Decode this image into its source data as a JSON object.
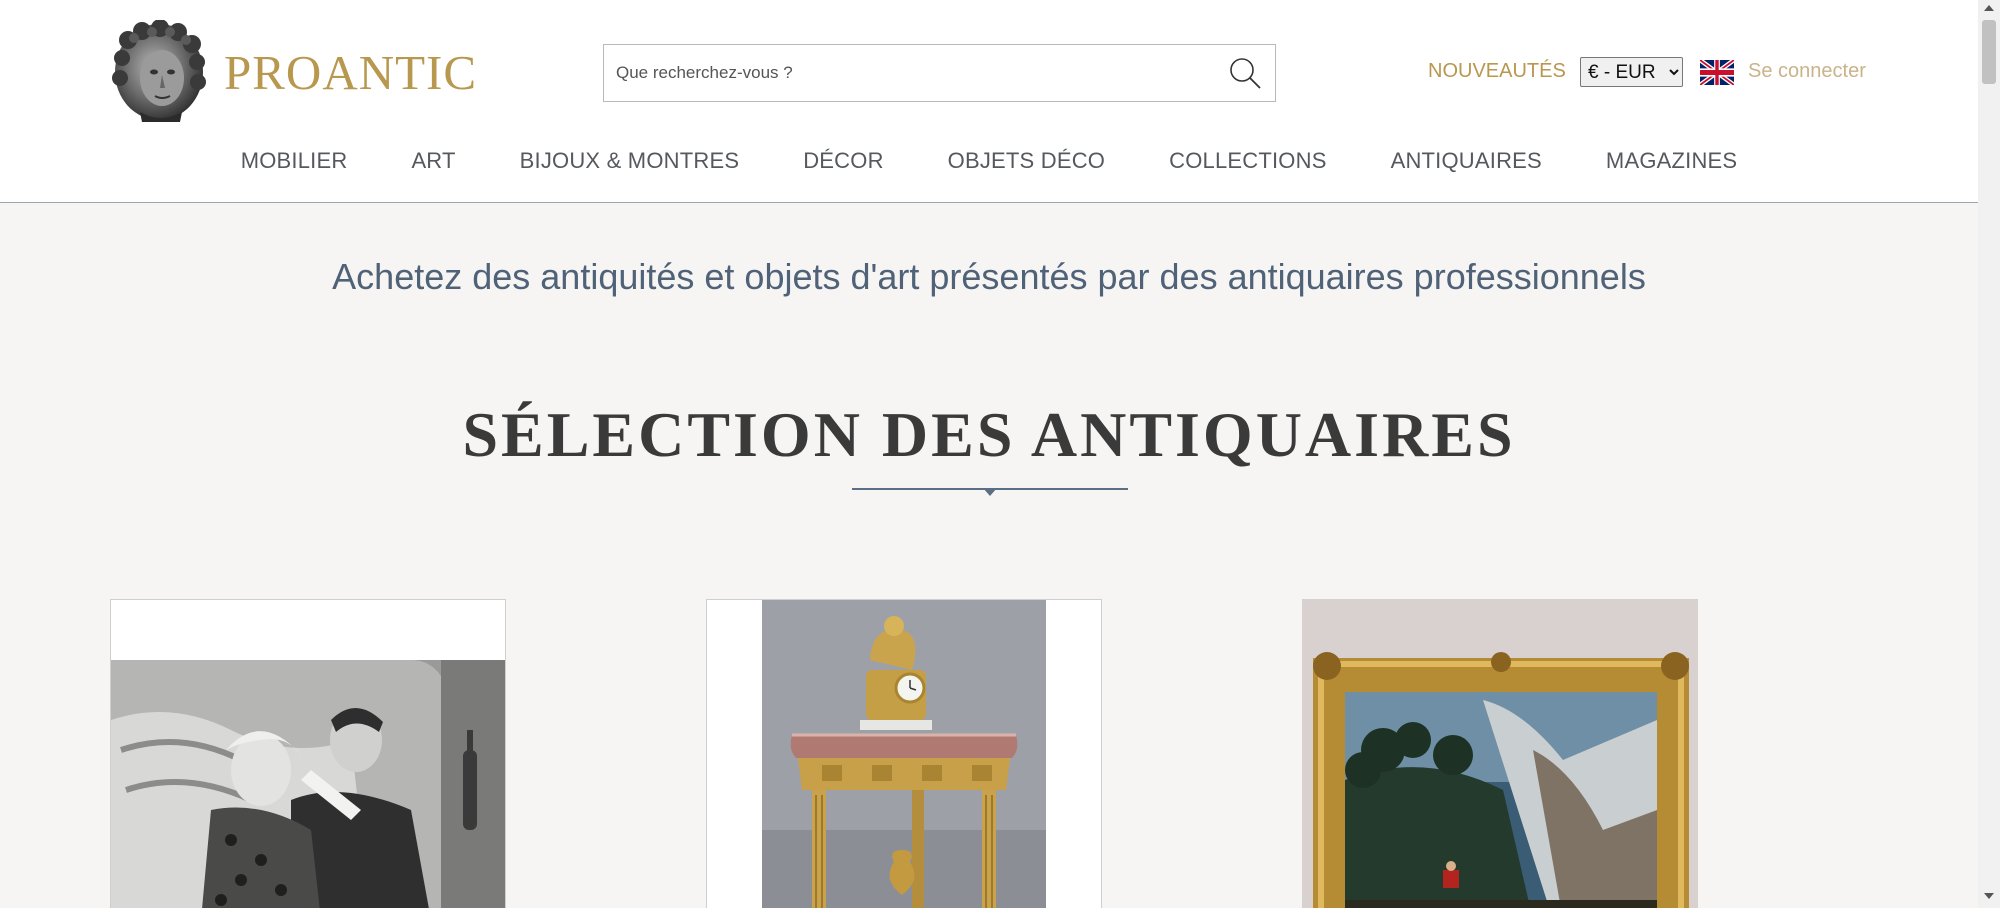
{
  "header": {
    "brand": "PROANTIC",
    "search": {
      "placeholder": "Que recherchez-vous ?",
      "value": ""
    },
    "new_label": "NOUVEAUTÉS",
    "currency": {
      "selected": "€ - EUR",
      "options": [
        "€ - EUR"
      ]
    },
    "language_flag": "uk-flag-icon",
    "login_label": "Se connecter"
  },
  "nav": {
    "items": [
      {
        "label": "MOBILIER"
      },
      {
        "label": "ART"
      },
      {
        "label": "BIJOUX & MONTRES"
      },
      {
        "label": "DÉCOR"
      },
      {
        "label": "OBJETS DÉCO"
      },
      {
        "label": "COLLECTIONS"
      },
      {
        "label": "ANTIQUAIRES"
      },
      {
        "label": "MAGAZINES"
      }
    ]
  },
  "main": {
    "tagline": "Achetez des antiquités et objets d'art présentés par des antiquaires professionnels",
    "section_title": "SÉLECTION DES ANTIQUAIRES"
  },
  "colors": {
    "brand_gold": "#b8974f",
    "login_gold": "#c9b38a",
    "tagline_blue": "#4f6278",
    "page_bg": "#f6f5f3"
  }
}
